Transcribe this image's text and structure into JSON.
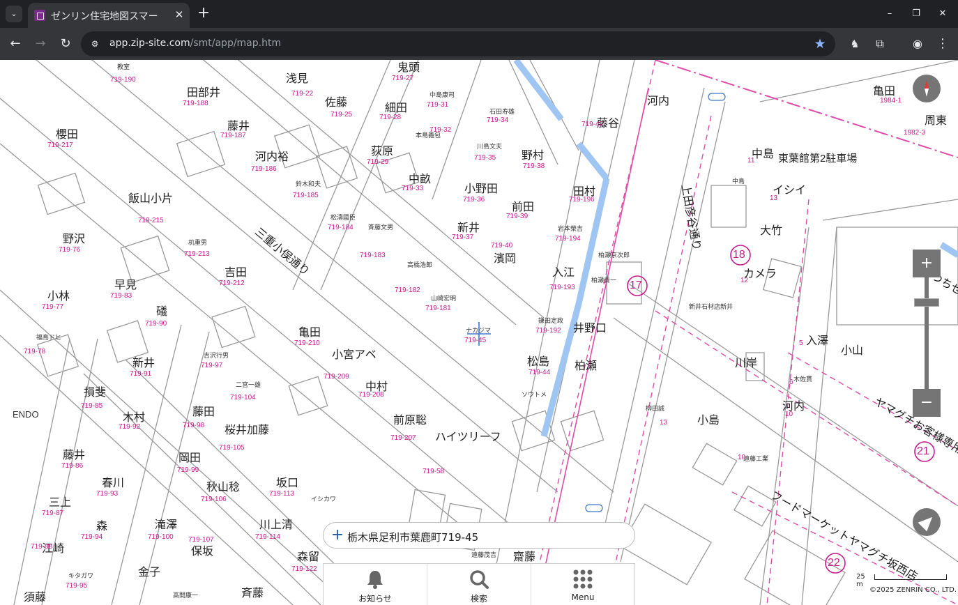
{
  "browser": {
    "tab_title": "ゼンリン住宅地図スマー",
    "url_host": "app.zip-site.com",
    "url_path": "/smt/app/map.htm"
  },
  "map": {
    "address": "栃木県足利市葉鹿町719-45",
    "scale_label": "25 m",
    "copyright": "©2025 ZENRIN CO., LTD.",
    "houses": [
      {
        "name": "教室",
        "num": "719-190"
      },
      {
        "name": "浅見",
        "num": "719-22"
      },
      {
        "name": "鬼頭",
        "num": "719-27"
      },
      {
        "name": "田部井",
        "num": "719-188"
      },
      {
        "name": "佐藤",
        "num": "719-25"
      },
      {
        "name": "中島康司",
        "num": "719-31"
      },
      {
        "name": "細田",
        "num": "719-28"
      },
      {
        "name": "石田寿雄",
        "num": "719-34"
      },
      {
        "name": "櫻田",
        "num": "719-217"
      },
      {
        "name": "藤井",
        "num": "719-187"
      },
      {
        "name": "本島義包",
        "num": "719-32"
      },
      {
        "name": "荻原",
        "num": "719-29"
      },
      {
        "name": "河内裕",
        "num": "719-186"
      },
      {
        "name": "川島文夫",
        "num": "719-35"
      },
      {
        "name": "野村",
        "num": "719-38"
      },
      {
        "name": "中畝",
        "num": "719-33"
      },
      {
        "name": "飯山小片",
        "num": "719-215"
      },
      {
        "name": "鈴木和夫",
        "num": "719-185"
      },
      {
        "name": "小野田",
        "num": "719-36"
      },
      {
        "name": "田村",
        "num": "719-196"
      },
      {
        "name": "前田",
        "num": "719-39"
      },
      {
        "name": "松濤國臣",
        "num": "719-184"
      },
      {
        "name": "岩本榮吉",
        "num": "719-194"
      },
      {
        "name": "新井",
        "num": "719-37"
      },
      {
        "name": "野沢",
        "num": "719-76"
      },
      {
        "name": "斉藤文男",
        "num": "719-183"
      },
      {
        "name": "濱岡",
        "num": "719-40"
      },
      {
        "name": "柏瀬京次郎",
        "num": ""
      },
      {
        "name": "机重男",
        "num": "719-213"
      },
      {
        "name": "入江",
        "num": "719-193"
      },
      {
        "name": "柏瀬貴一",
        "num": ""
      },
      {
        "name": "吉田",
        "num": "719-212"
      },
      {
        "name": "高橋浩郎",
        "num": "719-182"
      },
      {
        "name": "早見",
        "num": "719-83"
      },
      {
        "name": "小林",
        "num": "719-77"
      },
      {
        "name": "山崎宏明",
        "num": "719-181"
      },
      {
        "name": "礒",
        "num": "719-90"
      },
      {
        "name": "鎌田定政",
        "num": "719-192"
      },
      {
        "name": "井野口",
        "num": ""
      },
      {
        "name": "亀田",
        "num": "719-210"
      },
      {
        "name": "福島ドヒ",
        "num": "719-78"
      },
      {
        "name": "小宮アベ",
        "num": "719-209"
      },
      {
        "name": "吉沢行男",
        "num": "719-97"
      },
      {
        "name": "新井",
        "num": "719-91"
      },
      {
        "name": "松島",
        "num": "719-44"
      },
      {
        "name": "柏瀬",
        "num": ""
      },
      {
        "name": "中村",
        "num": "719-208"
      },
      {
        "name": "二宮一雄",
        "num": "719-104"
      },
      {
        "name": "損斐",
        "num": "719-85"
      },
      {
        "name": "ENDO",
        "num": ""
      },
      {
        "name": "木村",
        "num": "719-92"
      },
      {
        "name": "藤田",
        "num": "719-98"
      },
      {
        "name": "桜井加藤",
        "num": "719-105"
      },
      {
        "name": "前原聡",
        "num": "719-207"
      },
      {
        "name": "ハイツリーフ",
        "num": "719-58"
      },
      {
        "name": "藤井",
        "num": "719-86"
      },
      {
        "name": "春川",
        "num": "719-93"
      },
      {
        "name": "岡田",
        "num": "719-99"
      },
      {
        "name": "秋山稔",
        "num": "719-106"
      },
      {
        "name": "坂口",
        "num": "719-113"
      },
      {
        "name": "イシカワ",
        "num": ""
      },
      {
        "name": "三上",
        "num": "719-87"
      },
      {
        "name": "森",
        "num": "719-94"
      },
      {
        "name": "滝澤",
        "num": "719-100"
      },
      {
        "name": "保坂",
        "num": "719-107"
      },
      {
        "name": "川上清",
        "num": "719-114"
      },
      {
        "name": "江崎",
        "num": "719-88"
      },
      {
        "name": "キタガワ",
        "num": "719-95"
      },
      {
        "name": "金子",
        "num": ""
      },
      {
        "name": "森留",
        "num": "719-122"
      },
      {
        "name": "須藤",
        "num": ""
      },
      {
        "name": "高間康一",
        "num": ""
      },
      {
        "name": "斉藤",
        "num": ""
      },
      {
        "name": "遠藤茂吉",
        "num": ""
      },
      {
        "name": "齋藤",
        "num": ""
      },
      {
        "name": "河内",
        "num": ""
      },
      {
        "name": "藤谷",
        "num": "719-42"
      },
      {
        "name": "亀田",
        "num": "1984-1"
      },
      {
        "name": "周東",
        "num": "1982-3"
      },
      {
        "name": "中島",
        "num": "11"
      },
      {
        "name": "東葉館第2駐車場",
        "num": ""
      },
      {
        "name": "イシイ",
        "num": "13"
      },
      {
        "name": "大竹",
        "num": ""
      },
      {
        "name": "カメラ",
        "num": "12"
      },
      {
        "name": "新井石材店新井",
        "num": ""
      },
      {
        "name": "川岸",
        "num": ""
      },
      {
        "name": "入澤",
        "num": "5"
      },
      {
        "name": "小山",
        "num": ""
      },
      {
        "name": "木佐貫",
        "num": "6"
      },
      {
        "name": "河内",
        "num": "10"
      },
      {
        "name": "柳田誠",
        "num": "13"
      },
      {
        "name": "小島",
        "num": ""
      },
      {
        "name": "遠藤工業",
        "num": "10"
      },
      {
        "name": "ソウトメ",
        "num": ""
      },
      {
        "name": "中島",
        "num": "21"
      },
      {
        "name": "ナカジマ",
        "num": "719-45"
      }
    ],
    "roads": [
      {
        "name": "三重小俣通り"
      },
      {
        "name": "上田彦谷通り"
      }
    ],
    "areas": [
      {
        "name": "ヤマグチお客様専用駐車場"
      },
      {
        "name": "フードマーケットヤマグチ坂西店"
      },
      {
        "name": "つちせん商店"
      }
    ],
    "block_numbers": [
      "17",
      "18",
      "22",
      "21"
    ]
  },
  "menu": {
    "items": [
      {
        "label": "お知らせ",
        "icon": "bell-icon"
      },
      {
        "label": "検索",
        "icon": "search-icon"
      },
      {
        "label": "Menu",
        "icon": "grid-menu-icon"
      }
    ]
  }
}
